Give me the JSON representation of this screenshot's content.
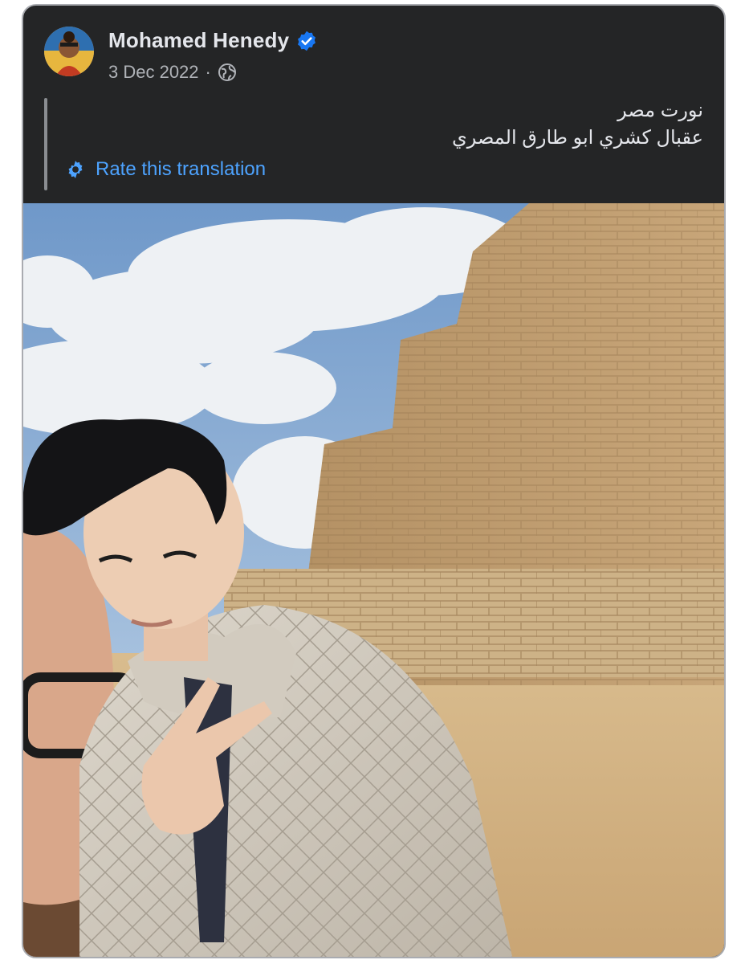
{
  "post": {
    "author_name": "Mohamed Henedy",
    "date": "3 Dec 2022",
    "separator": "·",
    "text_lines": [
      "نورت مصر",
      "عقبال كشري ابو طارق المصري"
    ],
    "rate_translation_label": "Rate this translation"
  },
  "icons": {
    "verified": "verified-badge-icon",
    "audience": "globe-icon",
    "rate": "gear-icon"
  },
  "colors": {
    "card_background": "#242526",
    "link": "#4da3ff",
    "verified": "#1877f2"
  }
}
